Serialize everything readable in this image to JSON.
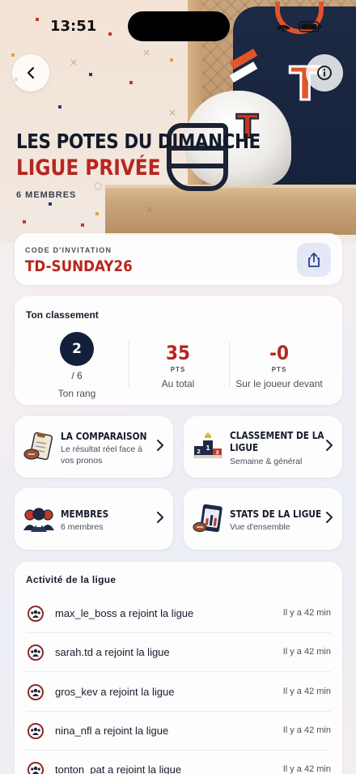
{
  "status_bar": {
    "time": "13:51"
  },
  "hero": {
    "title": "LES POTES DU DIMANCHE",
    "subtitle": "LIGUE PRIVÉE",
    "members": "6 MEMBRES"
  },
  "invite": {
    "label": "CODE D'INVITATION",
    "code": "TD-SUNDAY26"
  },
  "ranking": {
    "heading": "Ton classement",
    "rank": "2",
    "rank_total": "/ 6",
    "rank_caption": "Ton rang",
    "points": "35",
    "points_unit": "PTS",
    "points_caption": "Au total",
    "gap": "-0",
    "gap_unit": "PTS",
    "gap_caption": "Sur le joueur devant"
  },
  "tiles": [
    {
      "title": "LA COMPARAISON",
      "desc": "Le résultat réel face à vos pronos",
      "icon": "clipboard-football-icon"
    },
    {
      "title": "CLASSEMENT DE LA LIGUE",
      "desc": "Semaine & général",
      "icon": "podium-icon"
    },
    {
      "title": "MEMBRES",
      "desc": "6 membres",
      "icon": "team-players-icon"
    },
    {
      "title": "STATS DE LA LIGUE",
      "desc": "Vue d'ensemble",
      "icon": "stats-tablet-icon"
    }
  ],
  "activity": {
    "heading": "Activité de la ligue",
    "items": [
      {
        "text": "max_le_boss a rejoint la ligue",
        "time": "Il y a 42 min"
      },
      {
        "text": "sarah.td a rejoint la ligue",
        "time": "Il y a 42 min"
      },
      {
        "text": "gros_kev a rejoint la ligue",
        "time": "Il y a 42 min"
      },
      {
        "text": "nina_nfl a rejoint la ligue",
        "time": "Il y a 42 min"
      },
      {
        "text": "tonton_pat a rejoint la ligue",
        "time": "Il y a 42 min"
      }
    ]
  },
  "colors": {
    "accent_red": "#b8261d",
    "navy": "#13203a"
  }
}
